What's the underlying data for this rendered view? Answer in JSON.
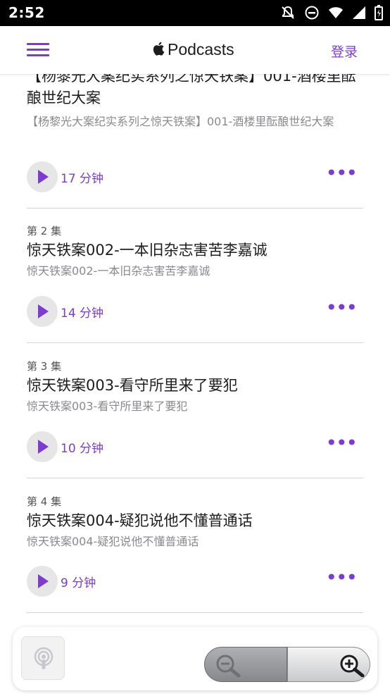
{
  "status": {
    "time": "2:52"
  },
  "header": {
    "brand": "Podcasts",
    "login": "登录"
  },
  "episodes": [
    {
      "number": "",
      "title": "【杨黎光大案纪实系列之惊天铁案】001-酒楼里酝酿世纪大案",
      "description": "【杨黎光大案纪实系列之惊天铁案】001-酒楼里酝酿世纪大案",
      "duration": "17 分钟"
    },
    {
      "number": "第 2 集",
      "title": "惊天铁案002-一本旧杂志害苦李嘉诚",
      "description": "惊天铁案002-一本旧杂志害苦李嘉诚",
      "duration": "14 分钟"
    },
    {
      "number": "第 3 集",
      "title": "惊天铁案003-看守所里来了要犯",
      "description": "惊天铁案003-看守所里来了要犯",
      "duration": "10 分钟"
    },
    {
      "number": "第 4 集",
      "title": "惊天铁案004-疑犯说他不懂普通话",
      "description": "惊天铁案004-疑犯说他不懂普通话",
      "duration": "9 分钟"
    }
  ],
  "colors": {
    "accent": "#7d3ccf"
  }
}
